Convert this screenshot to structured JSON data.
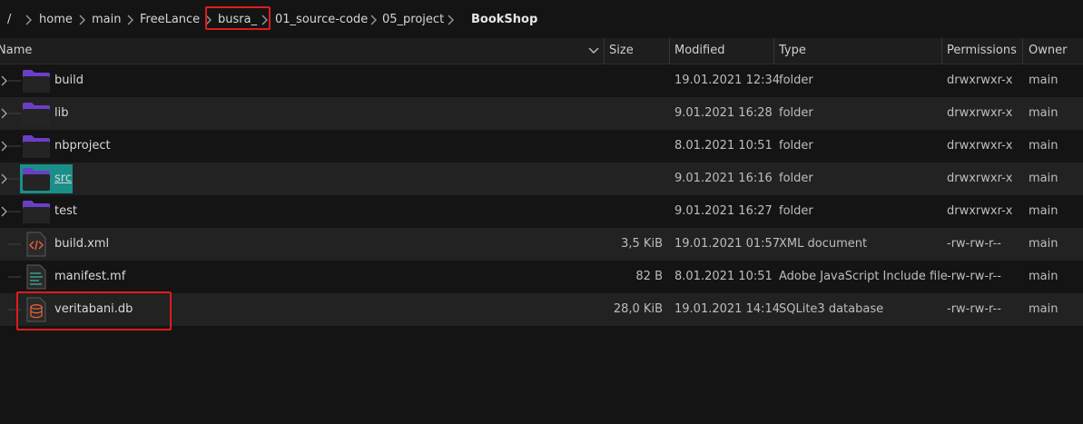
{
  "breadcrumb": {
    "items": [
      "/",
      "home",
      "main",
      "FreeLance",
      "busra_",
      "01_source-code",
      "05_project",
      "BookShop"
    ]
  },
  "columns": {
    "name": "Name",
    "size": "Size",
    "modified": "Modified",
    "type": "Type",
    "permissions": "Permissions",
    "owner": "Owner"
  },
  "rows": [
    {
      "name": "build",
      "size": "",
      "modified": "19.01.2021 12:34",
      "type": "folder",
      "permissions": "drwxrwxr-x",
      "owner": "main",
      "icon": "folder-icon"
    },
    {
      "name": "lib",
      "size": "",
      "modified": "9.01.2021 16:28",
      "type": "folder",
      "permissions": "drwxrwxr-x",
      "owner": "main",
      "icon": "folder-icon"
    },
    {
      "name": "nbproject",
      "size": "",
      "modified": "8.01.2021 10:51",
      "type": "folder",
      "permissions": "drwxrwxr-x",
      "owner": "main",
      "icon": "folder-icon"
    },
    {
      "name": "src",
      "size": "",
      "modified": "9.01.2021 16:16",
      "type": "folder",
      "permissions": "drwxrwxr-x",
      "owner": "main",
      "icon": "folder-icon"
    },
    {
      "name": "test",
      "size": "",
      "modified": "9.01.2021 16:27",
      "type": "folder",
      "permissions": "drwxrwxr-x",
      "owner": "main",
      "icon": "folder-icon"
    },
    {
      "name": "build.xml",
      "size": "3,5 KiB",
      "modified": "19.01.2021 01:57",
      "type": "XML document",
      "permissions": "-rw-rw-r--",
      "owner": "main",
      "icon": "xml-file-icon"
    },
    {
      "name": "manifest.mf",
      "size": "82 B",
      "modified": "8.01.2021 10:51",
      "type": "Adobe JavaScript Include file",
      "permissions": "-rw-rw-r--",
      "owner": "main",
      "icon": "text-file-icon"
    },
    {
      "name": "veritabani.db",
      "size": "28,0 KiB",
      "modified": "19.01.2021 14:14",
      "type": "SQLite3 database",
      "permissions": "-rw-rw-r--",
      "owner": "main",
      "icon": "database-file-icon"
    }
  ],
  "colors": {
    "background": "#141414",
    "alt_row": "#222222",
    "selection": "#1a8f8a",
    "folder": "#6a3fc8",
    "highlight_box": "#e01b1b"
  }
}
